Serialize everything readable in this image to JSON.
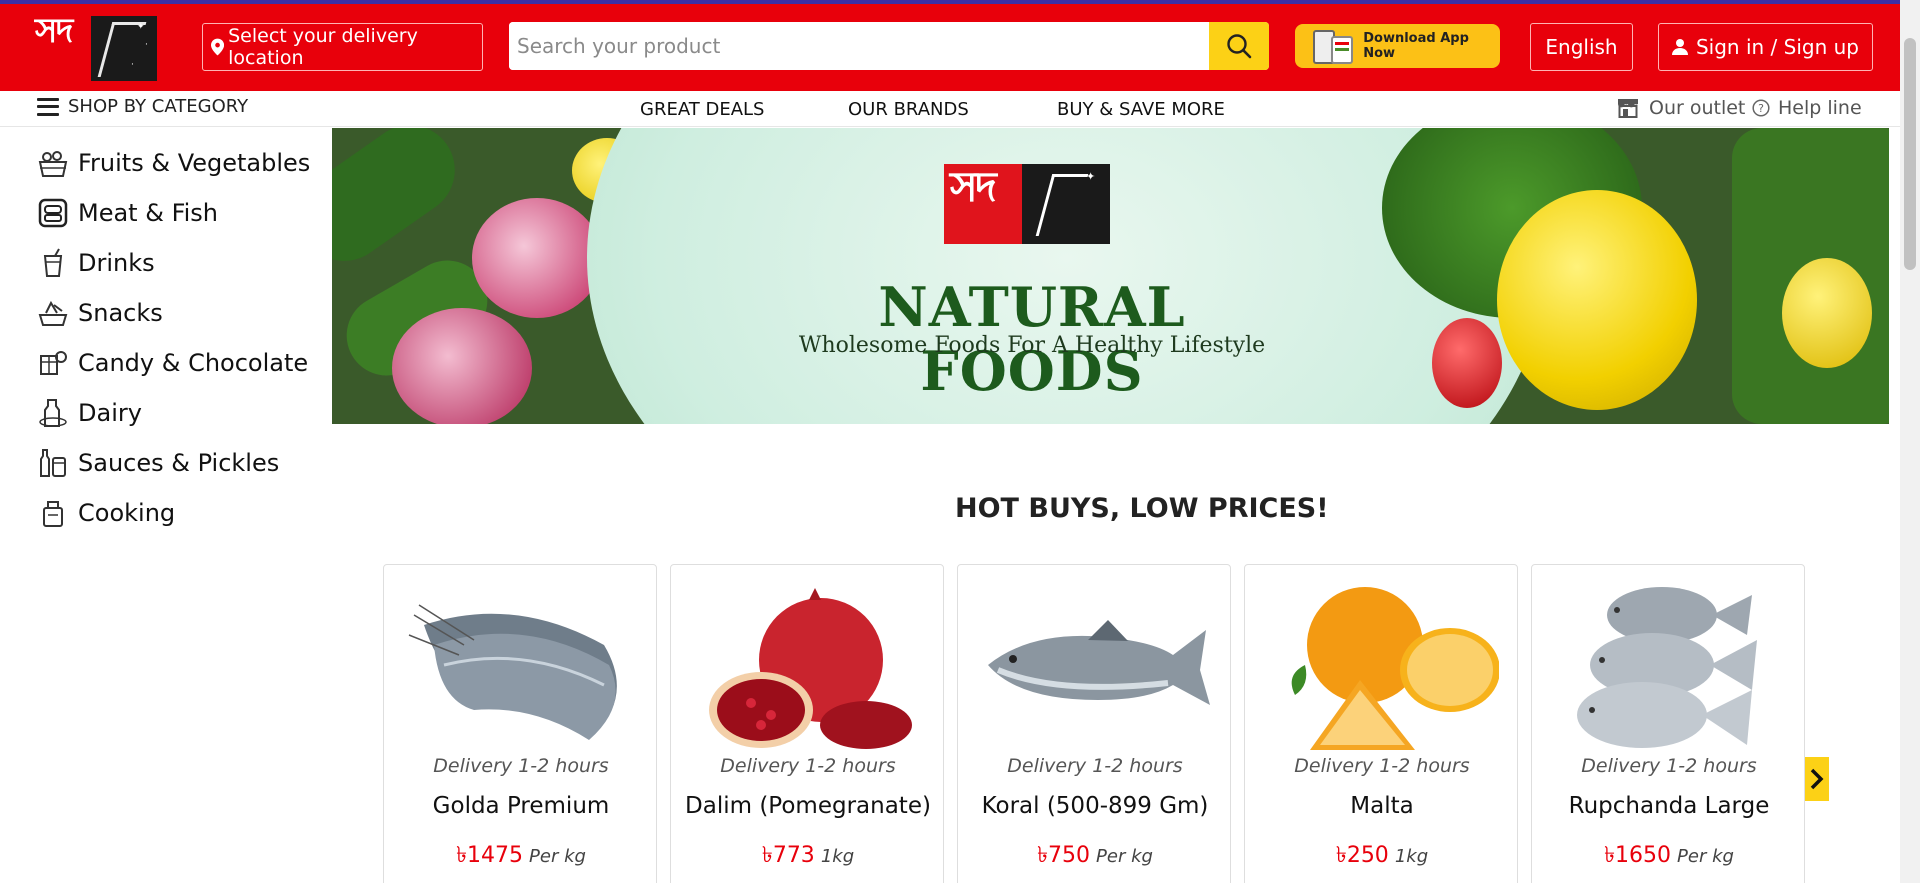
{
  "brand": {
    "logo_text": "সদ"
  },
  "header": {
    "location_label": "Select your delivery location",
    "search_placeholder": "Search your product",
    "app_label": "Download App Now",
    "language_label": "English",
    "signin_label": "Sign in / Sign up"
  },
  "nav": {
    "shop_by_category": "SHOP BY CATEGORY",
    "links": [
      "GREAT DEALS",
      "OUR BRANDS",
      "BUY & SAVE MORE"
    ],
    "outlet_label": "Our outlet",
    "help_label": "Help line"
  },
  "categories": [
    {
      "label": "Fruits & Vegetables",
      "icon": "fruit-basket-icon"
    },
    {
      "label": "Meat & Fish",
      "icon": "meat-icon"
    },
    {
      "label": "Drinks",
      "icon": "drink-icon"
    },
    {
      "label": "Snacks",
      "icon": "snacks-icon"
    },
    {
      "label": "Candy & Chocolate",
      "icon": "candy-icon"
    },
    {
      "label": "Dairy",
      "icon": "dairy-icon"
    },
    {
      "label": "Sauces & Pickles",
      "icon": "sauce-icon"
    },
    {
      "label": "Cooking",
      "icon": "cooking-icon"
    }
  ],
  "banner": {
    "title": "NATURAL FOODS",
    "subtitle": "Wholesome Foods For A Healthy Lifestyle"
  },
  "section": {
    "title": "HOT BUYS, LOW PRICES!"
  },
  "products": [
    {
      "delivery": "Delivery 1-2 hours",
      "name": "Golda Premium",
      "price": "৳1475",
      "unit": "Per kg",
      "image": "prawn"
    },
    {
      "delivery": "Delivery 1-2 hours",
      "name": "Dalim (Pomegranate)",
      "price": "৳773",
      "unit": "1kg",
      "image": "pomegranate"
    },
    {
      "delivery": "Delivery 1-2 hours",
      "name": "Koral (500-899 Gm)",
      "price": "৳750",
      "unit": "Per kg",
      "image": "fish"
    },
    {
      "delivery": "Delivery 1-2 hours",
      "name": "Malta",
      "price": "৳250",
      "unit": "1kg",
      "image": "orange"
    },
    {
      "delivery": "Delivery 1-2 hours",
      "name": "Rupchanda Large",
      "price": "৳1650",
      "unit": "Per kg",
      "image": "pomfret"
    }
  ],
  "colors": {
    "brand_red": "#e8000b",
    "accent_yellow": "#fcd116",
    "banner_green": "#1d5b1d"
  }
}
